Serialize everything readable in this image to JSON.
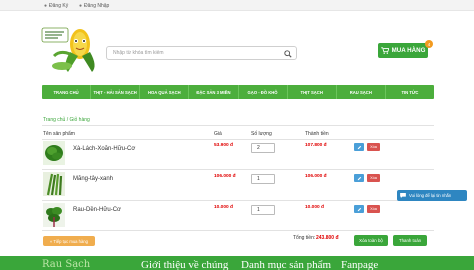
{
  "topbar": {
    "register_label": "Đăng Ký",
    "login_label": "Đăng Nhập"
  },
  "logo": {
    "alt": "corn mascot logo"
  },
  "search": {
    "placeholder": "Nhập từ khóa tìm kiếm",
    "value": ""
  },
  "cart": {
    "label": "MUA HÀNG",
    "count": "4"
  },
  "nav": {
    "items": [
      {
        "label": "TRANG CHỦ"
      },
      {
        "label": "THỊT - HẢI SẢN SẠCH"
      },
      {
        "label": "HOA QUẢ SẠCH"
      },
      {
        "label": "ĐẶC SẢN 3 MIỀN"
      },
      {
        "label": "GẠO - ĐỒ KHÔ"
      },
      {
        "label": "THỊT SẠCH"
      },
      {
        "label": "RAU SẠCH"
      },
      {
        "label": "TIN TỨC"
      }
    ]
  },
  "breadcrumb": "Trang chủ / Giỏ hàng",
  "table": {
    "headers": {
      "name": "Tên sản phẩm",
      "price": "Giá",
      "qty": "Số lượng",
      "total": "Thành tiền"
    },
    "rows": [
      {
        "name": "Xà-Lách-Xoăn-Hữu-Cơ",
        "price": "53.900 đ",
        "qty": "2",
        "total": "107.800 đ",
        "delete_label": "Xóa"
      },
      {
        "name": "Măng-tây-xanh",
        "price": "106.000 đ",
        "qty": "1",
        "total": "106.000 đ",
        "delete_label": "Xóa"
      },
      {
        "name": "Rau-Dền-Hữu-Cơ",
        "price": "10.000 đ",
        "qty": "1",
        "total": "10.000 đ",
        "delete_label": "Xóa"
      }
    ]
  },
  "summary": {
    "continue_label": "« Tiếp tục mua hàng",
    "grand_total_label": "Tổng tiền:",
    "grand_total_value": "243.800 đ",
    "clear_label": "Xóa toàn bộ",
    "checkout_label": "Thanh toán"
  },
  "chat": {
    "label": "Vui lòng để lại tin nhắn"
  },
  "footer": {
    "title": "Rau Sạch",
    "links": [
      {
        "label": "Giới thiệu về chúng"
      },
      {
        "label": "Danh mục sản phẩm"
      },
      {
        "label": "Fanpage"
      }
    ]
  },
  "colors": {
    "brand_green": "#3aa63a",
    "nav_green": "#4cae3c",
    "price_red": "#e00000",
    "delete_red": "#d9534f",
    "edit_blue": "#4a9fd8",
    "continue_orange": "#f0ad4e"
  }
}
